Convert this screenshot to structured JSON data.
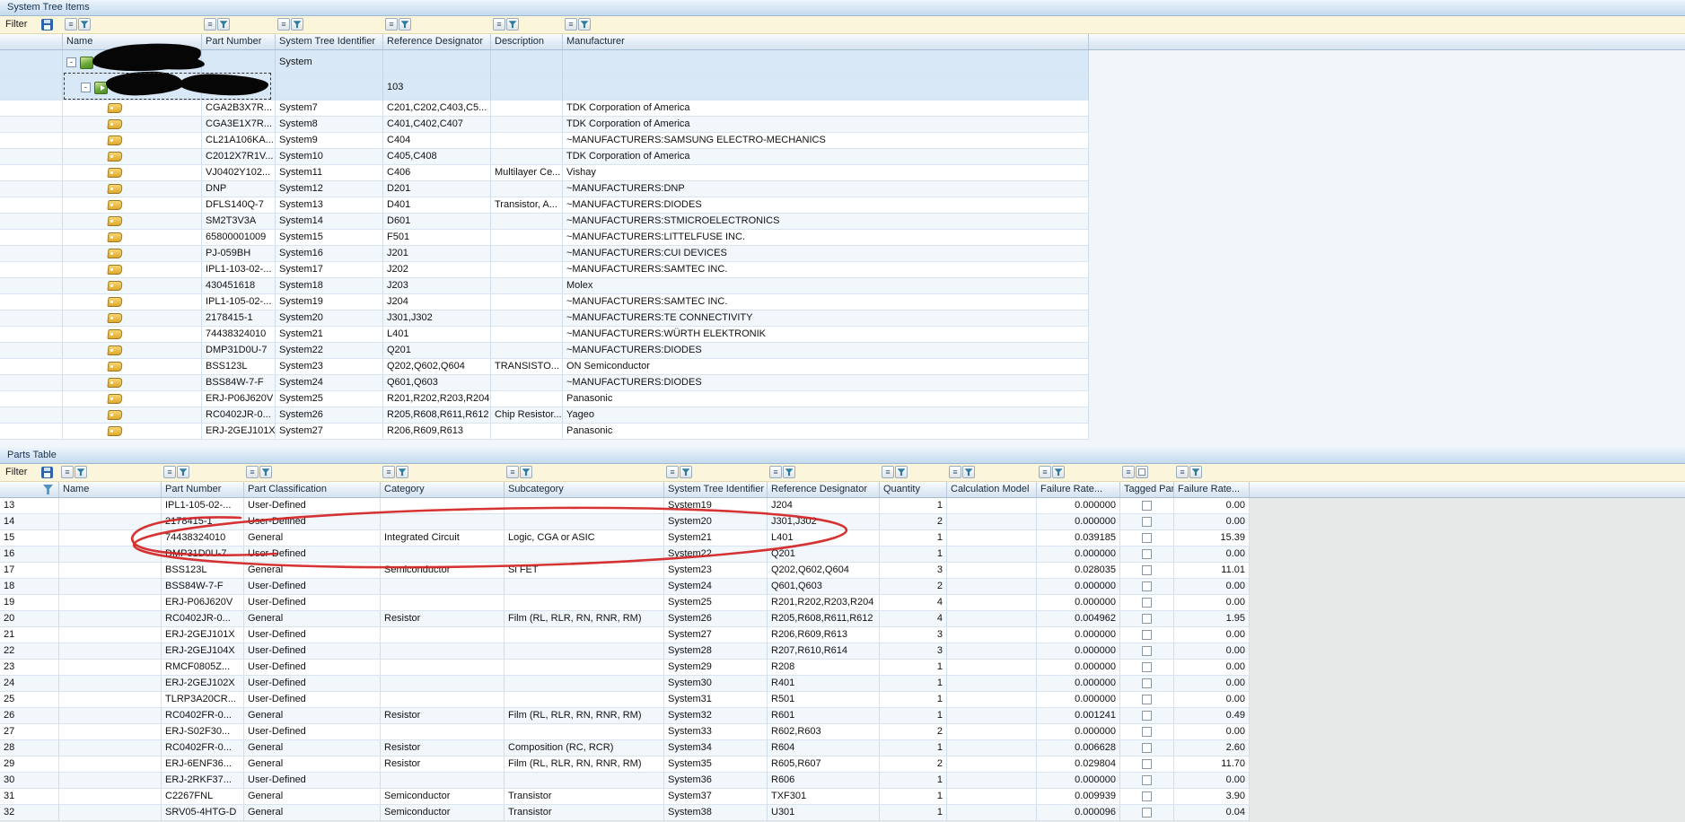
{
  "tree_panel": {
    "title": "System Tree Items",
    "filter_label": "Filter",
    "columns": [
      "Name",
      "Part Number",
      "System Tree Identifier",
      "Reference Designator",
      "Description",
      "Manufacturer"
    ],
    "root_row": {
      "name_redacted": true,
      "sti": "System"
    },
    "child_row": {
      "name_redacted": true,
      "ref_des": "103"
    },
    "part_rows": [
      {
        "part_number": "CGA2B3X7R...",
        "sti": "System7",
        "ref_des": "C201,C202,C403,C5...",
        "description": "",
        "manufacturer": "TDK Corporation of America"
      },
      {
        "part_number": "CGA3E1X7R...",
        "sti": "System8",
        "ref_des": "C401,C402,C407",
        "description": "",
        "manufacturer": "TDK Corporation of America"
      },
      {
        "part_number": "CL21A106KA...",
        "sti": "System9",
        "ref_des": "C404",
        "description": "",
        "manufacturer": "~MANUFACTURERS:SAMSUNG ELECTRO-MECHANICS"
      },
      {
        "part_number": "C2012X7R1V...",
        "sti": "System10",
        "ref_des": "C405,C408",
        "description": "",
        "manufacturer": "TDK Corporation of America"
      },
      {
        "part_number": "VJ0402Y102...",
        "sti": "System11",
        "ref_des": "C406",
        "description": "Multilayer Ce...",
        "manufacturer": "Vishay"
      },
      {
        "part_number": "DNP",
        "sti": "System12",
        "ref_des": "D201",
        "description": "",
        "manufacturer": "~MANUFACTURERS:DNP"
      },
      {
        "part_number": "DFLS140Q-7",
        "sti": "System13",
        "ref_des": "D401",
        "description": "Transistor, A...",
        "manufacturer": "~MANUFACTURERS:DIODES"
      },
      {
        "part_number": "SM2T3V3A",
        "sti": "System14",
        "ref_des": "D601",
        "description": "",
        "manufacturer": "~MANUFACTURERS:STMICROELECTRONICS"
      },
      {
        "part_number": "65800001009",
        "sti": "System15",
        "ref_des": "F501",
        "description": "",
        "manufacturer": "~MANUFACTURERS:LITTELFUSE INC."
      },
      {
        "part_number": "PJ-059BH",
        "sti": "System16",
        "ref_des": "J201",
        "description": "",
        "manufacturer": "~MANUFACTURERS:CUI DEVICES"
      },
      {
        "part_number": "IPL1-103-02-...",
        "sti": "System17",
        "ref_des": "J202",
        "description": "",
        "manufacturer": "~MANUFACTURERS:SAMTEC INC."
      },
      {
        "part_number": "430451618",
        "sti": "System18",
        "ref_des": "J203",
        "description": "",
        "manufacturer": "Molex"
      },
      {
        "part_number": "IPL1-105-02-...",
        "sti": "System19",
        "ref_des": "J204",
        "description": "",
        "manufacturer": "~MANUFACTURERS:SAMTEC INC."
      },
      {
        "part_number": "2178415-1",
        "sti": "System20",
        "ref_des": "J301,J302",
        "description": "",
        "manufacturer": "~MANUFACTURERS:TE CONNECTIVITY"
      },
      {
        "part_number": "74438324010",
        "sti": "System21",
        "ref_des": "L401",
        "description": "",
        "manufacturer": "~MANUFACTURERS:WÜRTH ELEKTRONIK"
      },
      {
        "part_number": "DMP31D0U-7",
        "sti": "System22",
        "ref_des": "Q201",
        "description": "",
        "manufacturer": "~MANUFACTURERS:DIODES"
      },
      {
        "part_number": "BSS123L",
        "sti": "System23",
        "ref_des": "Q202,Q602,Q604",
        "description": "TRANSISTO...",
        "manufacturer": "ON Semiconductor"
      },
      {
        "part_number": "BSS84W-7-F",
        "sti": "System24",
        "ref_des": "Q601,Q603",
        "description": "",
        "manufacturer": "~MANUFACTURERS:DIODES"
      },
      {
        "part_number": "ERJ-P06J620V",
        "sti": "System25",
        "ref_des": "R201,R202,R203,R204",
        "description": "",
        "manufacturer": "Panasonic"
      },
      {
        "part_number": "RC0402JR-0...",
        "sti": "System26",
        "ref_des": "R205,R608,R611,R612",
        "description": "Chip Resistor...",
        "manufacturer": "Yageo"
      },
      {
        "part_number": "ERJ-2GEJ101X",
        "sti": "System27",
        "ref_des": "R206,R609,R613",
        "description": "",
        "manufacturer": "Panasonic"
      }
    ]
  },
  "parts_panel": {
    "title": "Parts Table",
    "filter_label": "Filter",
    "columns": [
      "",
      "Name",
      "Part Number",
      "Part Classification",
      "Category",
      "Subcategory",
      "System Tree Identifier",
      "Reference Designator",
      "Quantity",
      "Calculation Model",
      "Failure Rate...",
      "Tagged Part?",
      "Failure Rate..."
    ],
    "rows": [
      {
        "num": "13",
        "part_number": "IPL1-105-02-...",
        "classification": "User-Defined",
        "category": "",
        "subcategory": "",
        "sti": "System19",
        "ref_des": "J204",
        "qty": "1",
        "calc_model": "",
        "fr1": "0.000000",
        "tagged": false,
        "fr2": "0.00"
      },
      {
        "num": "14",
        "part_number": "2178415-1",
        "classification": "User-Defined",
        "category": "",
        "subcategory": "",
        "sti": "System20",
        "ref_des": "J301,J302",
        "qty": "2",
        "calc_model": "",
        "fr1": "0.000000",
        "tagged": false,
        "fr2": "0.00"
      },
      {
        "num": "15",
        "part_number": "74438324010",
        "classification": "General",
        "category": "Integrated Circuit",
        "subcategory": "Logic, CGA or ASIC",
        "sti": "System21",
        "ref_des": "L401",
        "qty": "1",
        "calc_model": "",
        "fr1": "0.039185",
        "tagged": false,
        "fr2": "15.39"
      },
      {
        "num": "16",
        "part_number": "DMP31D0U-7",
        "classification": "User-Defined",
        "category": "",
        "subcategory": "",
        "sti": "System22",
        "ref_des": "Q201",
        "qty": "1",
        "calc_model": "",
        "fr1": "0.000000",
        "tagged": false,
        "fr2": "0.00"
      },
      {
        "num": "17",
        "part_number": "BSS123L",
        "classification": "General",
        "category": "Semiconductor",
        "subcategory": "Si FET",
        "sti": "System23",
        "ref_des": "Q202,Q602,Q604",
        "qty": "3",
        "calc_model": "",
        "fr1": "0.028035",
        "tagged": false,
        "fr2": "11.01"
      },
      {
        "num": "18",
        "part_number": "BSS84W-7-F",
        "classification": "User-Defined",
        "category": "",
        "subcategory": "",
        "sti": "System24",
        "ref_des": "Q601,Q603",
        "qty": "2",
        "calc_model": "",
        "fr1": "0.000000",
        "tagged": false,
        "fr2": "0.00"
      },
      {
        "num": "19",
        "part_number": "ERJ-P06J620V",
        "classification": "User-Defined",
        "category": "",
        "subcategory": "",
        "sti": "System25",
        "ref_des": "R201,R202,R203,R204",
        "qty": "4",
        "calc_model": "",
        "fr1": "0.000000",
        "tagged": false,
        "fr2": "0.00"
      },
      {
        "num": "20",
        "part_number": "RC0402JR-0...",
        "classification": "General",
        "category": "Resistor",
        "subcategory": "Film (RL, RLR, RN, RNR, RM)",
        "sti": "System26",
        "ref_des": "R205,R608,R611,R612",
        "qty": "4",
        "calc_model": "",
        "fr1": "0.004962",
        "tagged": false,
        "fr2": "1.95"
      },
      {
        "num": "21",
        "part_number": "ERJ-2GEJ101X",
        "classification": "User-Defined",
        "category": "",
        "subcategory": "",
        "sti": "System27",
        "ref_des": "R206,R609,R613",
        "qty": "3",
        "calc_model": "",
        "fr1": "0.000000",
        "tagged": false,
        "fr2": "0.00"
      },
      {
        "num": "22",
        "part_number": "ERJ-2GEJ104X",
        "classification": "User-Defined",
        "category": "",
        "subcategory": "",
        "sti": "System28",
        "ref_des": "R207,R610,R614",
        "qty": "3",
        "calc_model": "",
        "fr1": "0.000000",
        "tagged": false,
        "fr2": "0.00"
      },
      {
        "num": "23",
        "part_number": "RMCF0805Z...",
        "classification": "User-Defined",
        "category": "",
        "subcategory": "",
        "sti": "System29",
        "ref_des": "R208",
        "qty": "1",
        "calc_model": "",
        "fr1": "0.000000",
        "tagged": false,
        "fr2": "0.00"
      },
      {
        "num": "24",
        "part_number": "ERJ-2GEJ102X",
        "classification": "User-Defined",
        "category": "",
        "subcategory": "",
        "sti": "System30",
        "ref_des": "R401",
        "qty": "1",
        "calc_model": "",
        "fr1": "0.000000",
        "tagged": false,
        "fr2": "0.00"
      },
      {
        "num": "25",
        "part_number": "TLRP3A20CR...",
        "classification": "User-Defined",
        "category": "",
        "subcategory": "",
        "sti": "System31",
        "ref_des": "R501",
        "qty": "1",
        "calc_model": "",
        "fr1": "0.000000",
        "tagged": false,
        "fr2": "0.00"
      },
      {
        "num": "26",
        "part_number": "RC0402FR-0...",
        "classification": "General",
        "category": "Resistor",
        "subcategory": "Film (RL, RLR, RN, RNR, RM)",
        "sti": "System32",
        "ref_des": "R601",
        "qty": "1",
        "calc_model": "",
        "fr1": "0.001241",
        "tagged": false,
        "fr2": "0.49"
      },
      {
        "num": "27",
        "part_number": "ERJ-S02F30...",
        "classification": "User-Defined",
        "category": "",
        "subcategory": "",
        "sti": "System33",
        "ref_des": "R602,R603",
        "qty": "2",
        "calc_model": "",
        "fr1": "0.000000",
        "tagged": false,
        "fr2": "0.00"
      },
      {
        "num": "28",
        "part_number": "RC0402FR-0...",
        "classification": "General",
        "category": "Resistor",
        "subcategory": "Composition (RC, RCR)",
        "sti": "System34",
        "ref_des": "R604",
        "qty": "1",
        "calc_model": "",
        "fr1": "0.006628",
        "tagged": false,
        "fr2": "2.60"
      },
      {
        "num": "29",
        "part_number": "ERJ-6ENF36...",
        "classification": "General",
        "category": "Resistor",
        "subcategory": "Film (RL, RLR, RN, RNR, RM)",
        "sti": "System35",
        "ref_des": "R605,R607",
        "qty": "2",
        "calc_model": "",
        "fr1": "0.029804",
        "tagged": false,
        "fr2": "11.70"
      },
      {
        "num": "30",
        "part_number": "ERJ-2RKF37...",
        "classification": "User-Defined",
        "category": "",
        "subcategory": "",
        "sti": "System36",
        "ref_des": "R606",
        "qty": "1",
        "calc_model": "",
        "fr1": "0.000000",
        "tagged": false,
        "fr2": "0.00"
      },
      {
        "num": "31",
        "part_number": "C2267FNL",
        "classification": "General",
        "category": "Semiconductor",
        "subcategory": "Transistor",
        "sti": "System37",
        "ref_des": "TXF301",
        "qty": "1",
        "calc_model": "",
        "fr1": "0.009939",
        "tagged": false,
        "fr2": "3.90"
      },
      {
        "num": "32",
        "part_number": "SRV05-4HTG-D",
        "classification": "General",
        "category": "Semiconductor",
        "subcategory": "Transistor",
        "sti": "System38",
        "ref_des": "U301",
        "qty": "1",
        "calc_model": "",
        "fr1": "0.000096",
        "tagged": false,
        "fr2": "0.04"
      }
    ]
  },
  "annotations": {
    "red_circle": {
      "color": "#d32222",
      "circled_row_numbers": [
        "14",
        "15",
        "16"
      ]
    },
    "name_redactions_count": 2
  },
  "colors": {
    "selection_row": "#d9e8f7",
    "filter_row_bg": "#fbf5dc",
    "caption_gradient_top": "#ecf4fc",
    "caption_gradient_bottom": "#c4daee",
    "tag_yellow": "#e8b93c"
  }
}
